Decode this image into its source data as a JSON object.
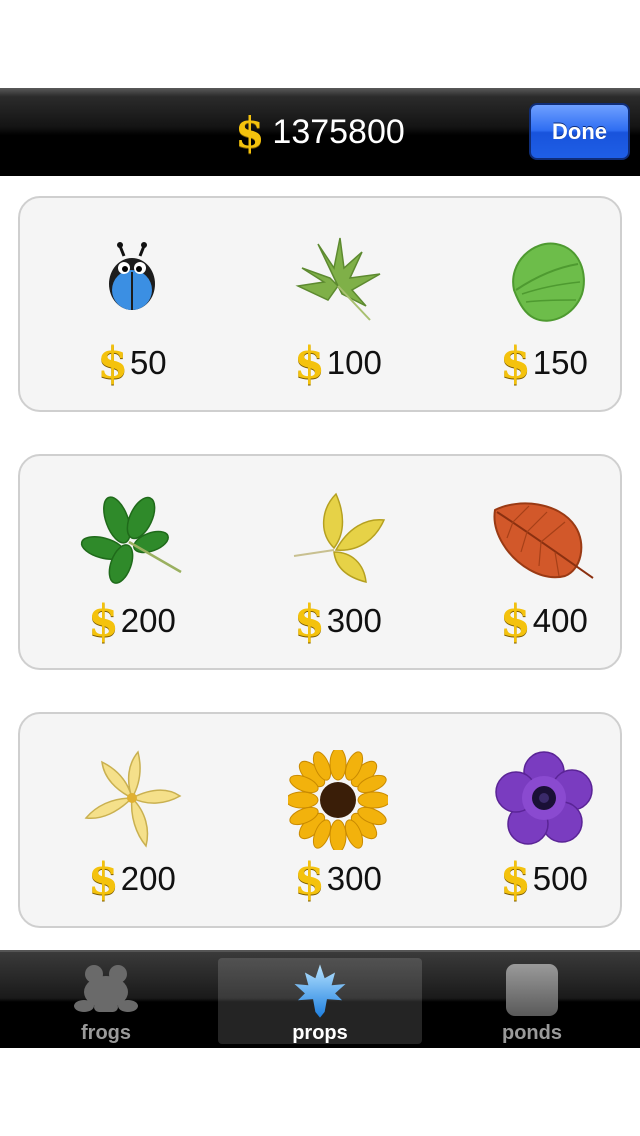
{
  "header": {
    "currency_symbol": "$",
    "balance": "1375800",
    "done_label": "Done"
  },
  "shelves": [
    {
      "items": [
        {
          "icon": "bug-icon",
          "price": "50"
        },
        {
          "icon": "maple-leaf-icon",
          "price": "100"
        },
        {
          "icon": "round-leaf-icon",
          "price": "150"
        }
      ]
    },
    {
      "items": [
        {
          "icon": "clover-leaf-icon",
          "price": "200"
        },
        {
          "icon": "yellow-leaf-icon",
          "price": "300"
        },
        {
          "icon": "red-leaf-icon",
          "price": "400"
        }
      ]
    },
    {
      "items": [
        {
          "icon": "lily-flower-icon",
          "price": "200"
        },
        {
          "icon": "sunflower-icon",
          "price": "300"
        },
        {
          "icon": "purple-flower-icon",
          "price": "500"
        }
      ]
    }
  ],
  "tabs": [
    {
      "label": "frogs",
      "icon": "frog-icon",
      "active": false
    },
    {
      "label": "props",
      "icon": "maple-leaf-icon",
      "active": true
    },
    {
      "label": "ponds",
      "icon": "pond-icon",
      "active": false
    }
  ],
  "colors": {
    "currency": "#f4c20d",
    "done_button": "#2e6df2"
  }
}
